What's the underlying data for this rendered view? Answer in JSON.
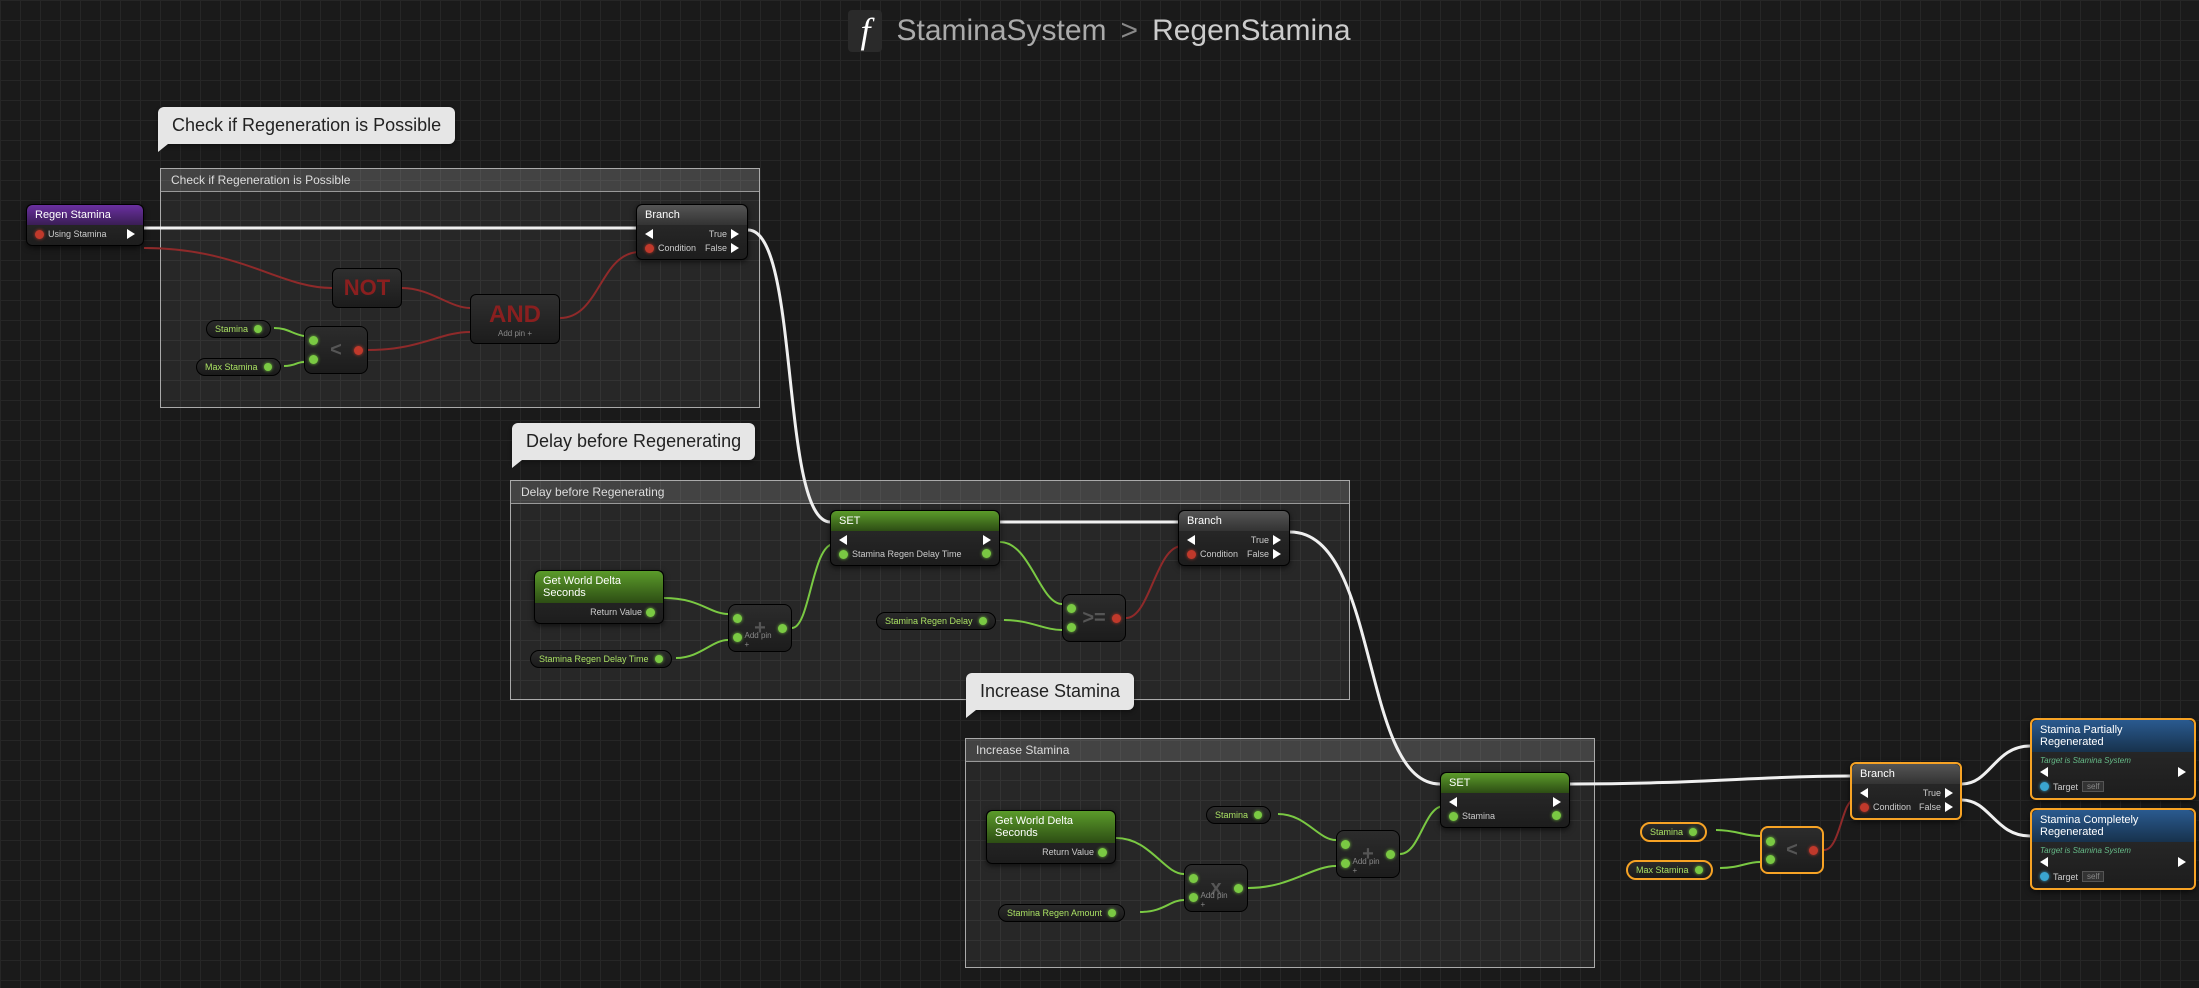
{
  "header": {
    "icon": "f",
    "crumb1": "StaminaSystem",
    "sep": ">",
    "crumb2": "RegenStamina"
  },
  "tooltips": {
    "t1": "Check if Regeneration is Possible",
    "t2": "Delay before Regenerating",
    "t3": "Increase Stamina"
  },
  "regions": {
    "r1": "Check if Regeneration is Possible",
    "r2": "Delay before Regenerating",
    "r3": "Increase Stamina"
  },
  "entry": {
    "title": "Regen Stamina",
    "pin": "Using Stamina"
  },
  "branch": {
    "title": "Branch",
    "cond": "Condition",
    "true": "True",
    "false": "False"
  },
  "ops": {
    "not": "NOT",
    "and": "AND",
    "lt": "<",
    "gte": ">=",
    "plus": "+",
    "mult": "x",
    "addpin": "Add pin +"
  },
  "vars": {
    "stamina": "Stamina",
    "maxStamina": "Max Stamina",
    "staminaRegenDelayTime": "Stamina Regen Delay Time",
    "staminaRegenDelay": "Stamina Regen Delay",
    "staminaRegenAmount": "Stamina Regen Amount"
  },
  "setnode": {
    "title": "SET",
    "out1": "Stamina Regen Delay Time",
    "out2": "Stamina"
  },
  "worldDelta": {
    "title": "Get World Delta Seconds",
    "ret": "Return Value"
  },
  "events": {
    "partial": {
      "title": "Stamina Partially Regenerated",
      "sub": "Target is Stamina System",
      "target": "Target",
      "self": "self"
    },
    "complete": {
      "title": "Stamina Completely Regenerated",
      "sub": "Target is Stamina System",
      "target": "Target",
      "self": "self"
    }
  }
}
